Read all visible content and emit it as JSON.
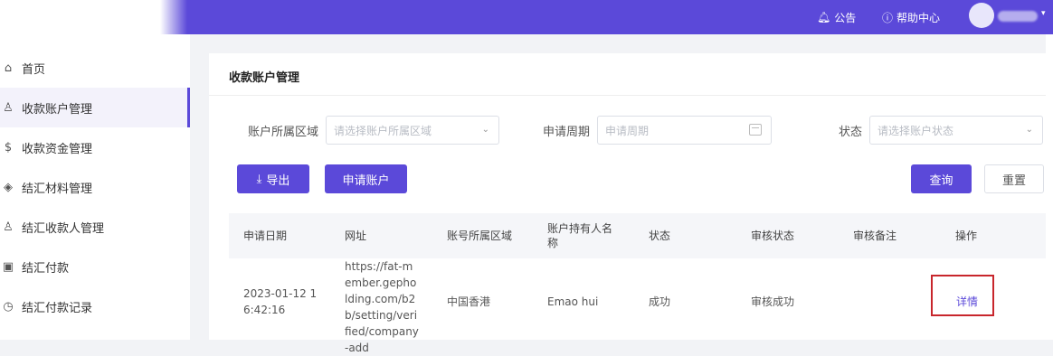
{
  "topbar": {
    "announcement": "公告",
    "help": "帮助中心",
    "caret": "▾"
  },
  "sidebar": {
    "items": [
      {
        "label": "首页",
        "icon": "home-icon",
        "glyph": "⌂"
      },
      {
        "label": "收款账户管理",
        "icon": "user-icon",
        "glyph": "♙"
      },
      {
        "label": "收款资金管理",
        "icon": "dollar-circle-icon",
        "glyph": "$"
      },
      {
        "label": "结汇材料管理",
        "icon": "layers-icon",
        "glyph": "◈"
      },
      {
        "label": "结汇收款人管理",
        "icon": "payee-icon",
        "glyph": "♙"
      },
      {
        "label": "结汇付款",
        "icon": "payment-icon",
        "glyph": "▣"
      },
      {
        "label": "结汇付款记录",
        "icon": "clock-icon",
        "glyph": "◷"
      }
    ],
    "active_index": 1
  },
  "page": {
    "title": "收款账户管理"
  },
  "filters": {
    "region_label": "账户所属区域",
    "region_placeholder": "请选择账户所属区域",
    "period_label": "申请周期",
    "period_placeholder": "申请周期",
    "status_label": "状态",
    "status_placeholder": "请选择账户状态"
  },
  "buttons": {
    "export": "导出",
    "export_icon": "⤓",
    "apply": "申请账户",
    "query": "查询",
    "reset": "重置"
  },
  "table": {
    "headers": [
      "申请日期",
      "网址",
      "账号所属区域",
      "账户持有人名称",
      "状态",
      "审核状态",
      "审核备注",
      "操作"
    ],
    "rows": [
      {
        "date": "2023-01-12 16:42:16",
        "url": "https://fat-member.gepholding.com/b2b/setting/verified/company-add",
        "region": "中国香港",
        "holder": "Emao hui",
        "status": "成功",
        "review_status": "审核成功",
        "review_note": "",
        "action": "详情"
      }
    ]
  },
  "colors": {
    "brand": "#5b49d9",
    "highlight_box": "#c8262c"
  }
}
